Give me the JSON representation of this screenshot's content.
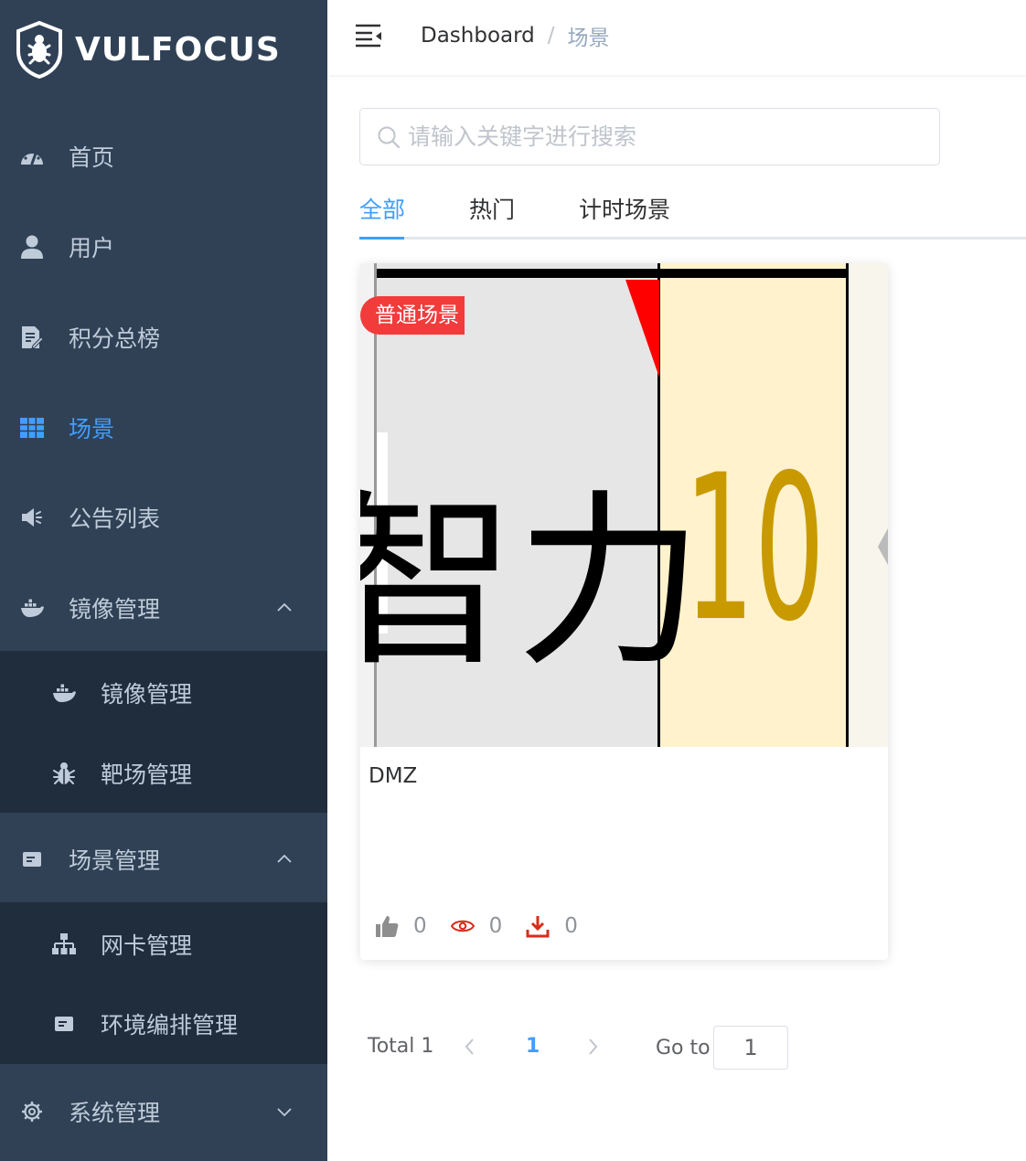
{
  "brand": {
    "name": "VULFOCUS"
  },
  "sidebar": {
    "items": [
      {
        "label": "首页",
        "icon": "dashboard-icon"
      },
      {
        "label": "用户",
        "icon": "user-icon"
      },
      {
        "label": "积分总榜",
        "icon": "edit-document-icon"
      },
      {
        "label": "场景",
        "icon": "table-grid-icon",
        "active": true
      },
      {
        "label": "公告列表",
        "icon": "speaker-icon"
      },
      {
        "label": "镜像管理",
        "icon": "docker-icon",
        "expanded": true
      },
      {
        "label": "场景管理",
        "icon": "form-icon",
        "expanded": true
      },
      {
        "label": "系统管理",
        "icon": "gear-icon",
        "expanded": false
      }
    ],
    "image_submenu": [
      {
        "label": "镜像管理",
        "icon": "docker-icon"
      },
      {
        "label": "靶场管理",
        "icon": "bug-icon"
      }
    ],
    "scene_submenu": [
      {
        "label": "网卡管理",
        "icon": "network-tree-icon"
      },
      {
        "label": "环境编排管理",
        "icon": "form-icon"
      }
    ],
    "active_color": "#409eff",
    "bg_color": "#304156",
    "submenu_bg_color": "#1f2d3d"
  },
  "header": {
    "breadcrumb": [
      "Dashboard",
      "场景"
    ],
    "separator": "/"
  },
  "search": {
    "placeholder": "请输入关键字进行搜索",
    "value": ""
  },
  "tabs": [
    {
      "label": "全部",
      "active": true
    },
    {
      "label": "热门",
      "active": false
    },
    {
      "label": "计时场景",
      "active": false
    }
  ],
  "cards": [
    {
      "badge": "普通场景",
      "title": "DMZ",
      "thumbnail_text": [
        "智力",
        "10"
      ],
      "likes": "0",
      "views": "0",
      "downloads": "0"
    }
  ],
  "pagination": {
    "total_label": "Total 1",
    "current_page": "1",
    "goto_label": "Go to",
    "goto_value": "1"
  }
}
